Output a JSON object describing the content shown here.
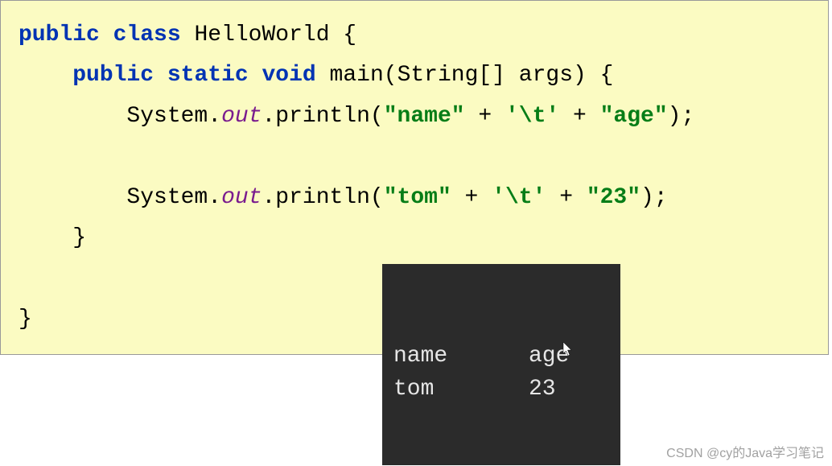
{
  "code": {
    "kw_public": "public",
    "kw_class": "class",
    "kw_static": "static",
    "kw_void": "void",
    "class_name": "HelloWorld",
    "method_name": "main",
    "param_type": "String[]",
    "param_name": "args",
    "sys": "System",
    "out": "out",
    "println": "println",
    "str_name": "\"name\"",
    "str_age": "\"age\"",
    "str_tom": "\"tom\"",
    "str_23": "\"23\"",
    "chr_tab": "'\\t'",
    "plus": " + ",
    "dot": ".",
    "semi": ";",
    "lbrace": " {",
    "rbrace": "}",
    "lparen": "(",
    "rparen": ")"
  },
  "output": {
    "row1_col1": "name",
    "row1_col2": "age",
    "row2_col1": "tom",
    "row2_col2": "23"
  },
  "watermark": "CSDN @cy的Java学习笔记"
}
